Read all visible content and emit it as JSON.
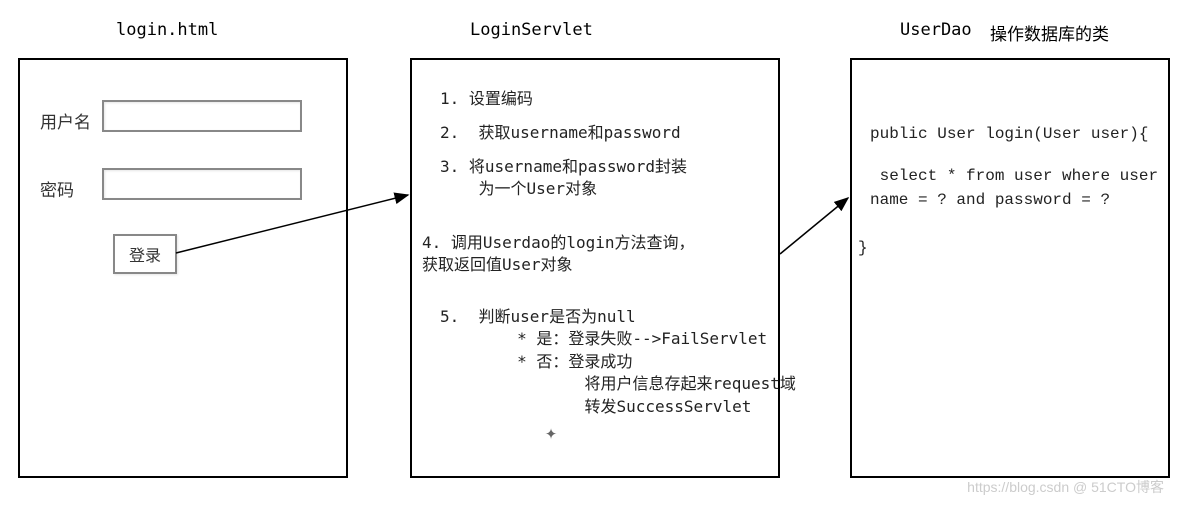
{
  "titles": {
    "login_html": "login.html",
    "login_servlet": "LoginServlet",
    "user_dao": "UserDao",
    "dao_desc": "操作数据库的类"
  },
  "login_form": {
    "username_label": "用户名",
    "password_label": "密码",
    "login_button": "登录"
  },
  "servlet_steps": {
    "s1": "1. 设置编码",
    "s2": "2.  获取username和password",
    "s3": "3. 将username和password封装\n    为一个User对象",
    "s4": "4. 调用Userdao的login方法查询，\n获取返回值User对象",
    "s5": "5.  判断user是否为null\n        * 是：登录失败-->FailServlet\n        * 否：登录成功\n               将用户信息存起来request域\n               转发SuccessServlet"
  },
  "dao_code": {
    "line1": "public User login(User user){",
    "line2": " select * from user where user\nname = ? and password = ?",
    "line3": "}"
  },
  "watermark": "https://blog.csdn @ 51CTO博客"
}
